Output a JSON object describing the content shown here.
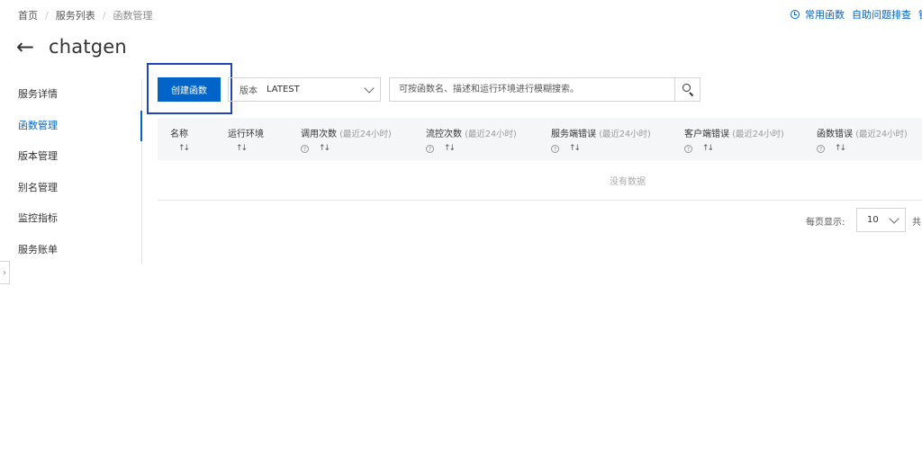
{
  "breadcrumb": {
    "home": "首页",
    "service_list": "服务列表",
    "current": "函数管理"
  },
  "top_links": {
    "common_functions": "常用函数",
    "self_troubleshoot": "自助问题排查",
    "more": "钉"
  },
  "header": {
    "title": "chatgen"
  },
  "sidebar": {
    "items": [
      {
        "label": "服务详情"
      },
      {
        "label": "函数管理"
      },
      {
        "label": "版本管理"
      },
      {
        "label": "别名管理"
      },
      {
        "label": "监控指标"
      },
      {
        "label": "服务账单"
      }
    ],
    "active_index": 1
  },
  "toolbar": {
    "create_label": "创建函数",
    "version_label": "版本",
    "version_value": "LATEST",
    "search_placeholder": "可按函数名、描述和运行环境进行模糊搜索。"
  },
  "table": {
    "columns": [
      {
        "label": "名称",
        "sub": ""
      },
      {
        "label": "运行环境",
        "sub": ""
      },
      {
        "label": "调用次数",
        "sub": "(最近24小时)"
      },
      {
        "label": "流控次数",
        "sub": "(最近24小时)"
      },
      {
        "label": "服务端错误",
        "sub": "(最近24小时)"
      },
      {
        "label": "客户端错误",
        "sub": "(最近24小时)"
      },
      {
        "label": "函数错误",
        "sub": "(最近24小时)"
      }
    ],
    "empty_text": "没有数据"
  },
  "pagination": {
    "per_page_label": "每页显示:",
    "page_size": "10",
    "total_label": "共"
  },
  "colors": {
    "primary": "#0064c8",
    "highlight_border": "#2244bb"
  }
}
